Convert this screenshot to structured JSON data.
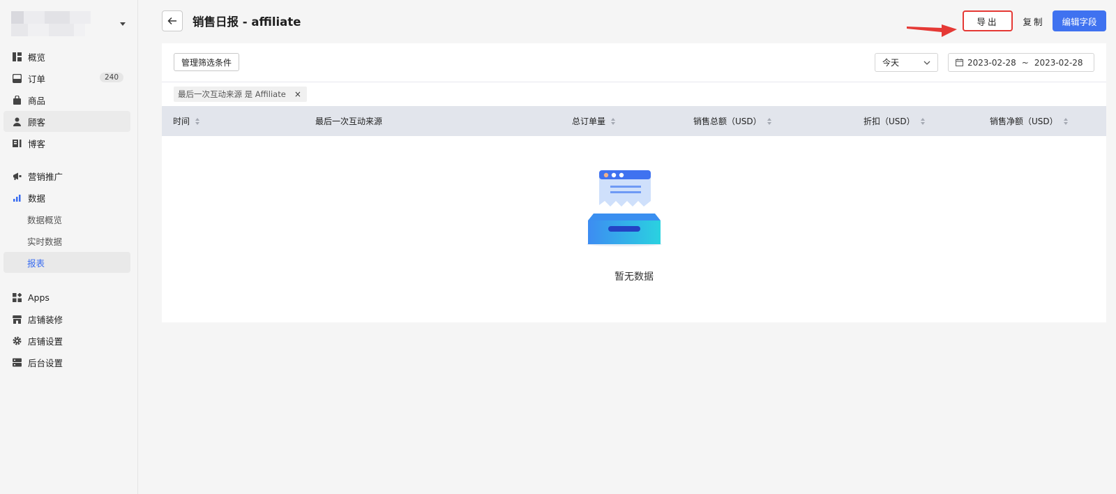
{
  "sidebar": {
    "items": [
      {
        "label": "概览",
        "icon": "dashboard-icon"
      },
      {
        "label": "订单",
        "icon": "inbox-icon",
        "badge": "240"
      },
      {
        "label": "商品",
        "icon": "bag-icon"
      },
      {
        "label": "顾客",
        "icon": "user-icon"
      },
      {
        "label": "博客",
        "icon": "blog-icon"
      },
      {
        "label": "营销推广",
        "icon": "megaphone-icon"
      },
      {
        "label": "数据",
        "icon": "bar-chart-icon"
      },
      {
        "label": "Apps",
        "icon": "apps-icon"
      },
      {
        "label": "店铺装修",
        "icon": "store-icon"
      },
      {
        "label": "店铺设置",
        "icon": "gear-icon"
      },
      {
        "label": "后台设置",
        "icon": "server-icon"
      }
    ],
    "sub_items": [
      {
        "label": "数据概览"
      },
      {
        "label": "实时数据"
      },
      {
        "label": "报表"
      }
    ]
  },
  "header": {
    "title": "销售日报 - affiliate",
    "export_label": "导出",
    "copy_label": "复制",
    "edit_label": "编辑字段"
  },
  "toolbar": {
    "filter_button": "管理筛选条件",
    "range_value": "今天",
    "date_start": "2023-02-28",
    "date_sep": "~",
    "date_end": "2023-02-28"
  },
  "filter_chip": {
    "text": "最后一次互动来源 是 Affiliate",
    "close": "×"
  },
  "table": {
    "columns": [
      {
        "label": "时间",
        "sortable": true
      },
      {
        "label": "最后一次互动来源",
        "sortable": false
      },
      {
        "label": "总订单量",
        "sortable": true
      },
      {
        "label": "销售总额（USD）",
        "sortable": true
      },
      {
        "label": "折扣（USD）",
        "sortable": true
      },
      {
        "label": "销售净额（USD）",
        "sortable": true
      }
    ],
    "empty_text": "暂无数据"
  },
  "colors": {
    "primary": "#3f72f0",
    "annotation": "#e53935"
  }
}
